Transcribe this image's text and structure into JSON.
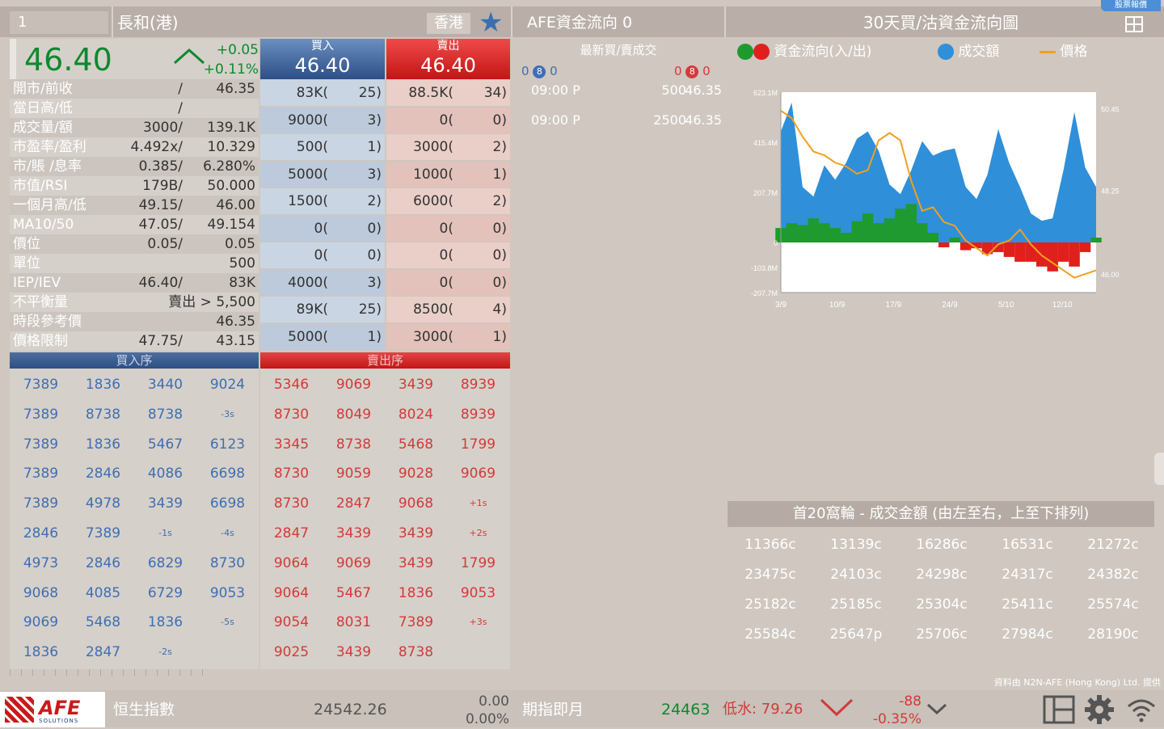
{
  "header": {
    "code": "1",
    "name": "長和(港)",
    "market": "香港",
    "afe_title": "AFE資金流向 0",
    "chart_title": "30天買/沽資金流向圖",
    "corner_badge": "股票報價"
  },
  "quote": {
    "price": "46.40",
    "change": "+0.05",
    "change_pct": "+0.11%",
    "rows": [
      {
        "label": "開市/前收",
        "v1": "/",
        "v2": "46.35"
      },
      {
        "label": "當日高/低",
        "v1": "/",
        "v2": ""
      },
      {
        "label": "成交量/額",
        "v1": "3000/",
        "v2": "139.1K"
      },
      {
        "label": "市盈率/盈利",
        "v1": "4.492x/",
        "v2": "10.329"
      },
      {
        "label": "市/賬 /息率",
        "v1": "0.385/",
        "v2": "6.280%"
      },
      {
        "label": "市值/RSI",
        "v1": "179B/",
        "v2": "50.000"
      },
      {
        "label": "一個月高/低",
        "v1": "49.15/",
        "v2": "46.00"
      },
      {
        "label": "MA10/50",
        "v1": "47.05/",
        "v2": "49.154"
      },
      {
        "label": "價位",
        "v1": "0.05/",
        "v2": "0.05"
      },
      {
        "label": "單位",
        "v1": "",
        "v2": "500"
      },
      {
        "label": "IEP/IEV",
        "v1": "46.40/",
        "v2": "83K"
      },
      {
        "label": "不平衡量",
        "v1": "",
        "v2": "賣出 > 5,500"
      },
      {
        "label": "時段參考價",
        "v1": "",
        "v2": "46.35"
      },
      {
        "label": "價格限制",
        "v1": "47.75/",
        "v2": "43.15"
      }
    ]
  },
  "orderbook": {
    "buy_label": "買入",
    "sell_label": "賣出",
    "bid": "46.40",
    "ask": "46.40",
    "bids": [
      {
        "q": "83K(",
        "n": "25)"
      },
      {
        "q": "9000(",
        "n": "3)"
      },
      {
        "q": "500(",
        "n": "1)"
      },
      {
        "q": "5000(",
        "n": "3)"
      },
      {
        "q": "1500(",
        "n": "2)"
      },
      {
        "q": "0(",
        "n": "0)"
      },
      {
        "q": "0(",
        "n": "0)"
      },
      {
        "q": "4000(",
        "n": "3)"
      },
      {
        "q": "89K(",
        "n": "25)"
      },
      {
        "q": "5000(",
        "n": "1)"
      }
    ],
    "asks": [
      {
        "q": "88.5K(",
        "n": "34)"
      },
      {
        "q": "0(",
        "n": "0)"
      },
      {
        "q": "3000(",
        "n": "2)"
      },
      {
        "q": "1000(",
        "n": "1)"
      },
      {
        "q": "6000(",
        "n": "2)"
      },
      {
        "q": "0(",
        "n": "0)"
      },
      {
        "q": "0(",
        "n": "0)"
      },
      {
        "q": "0(",
        "n": "0)"
      },
      {
        "q": "8500(",
        "n": "4)"
      },
      {
        "q": "3000(",
        "n": "1)"
      }
    ]
  },
  "queue": {
    "buy_title": "買入序",
    "sell_title": "賣出序",
    "buy": [
      [
        "7389",
        "1836",
        "3440",
        "9024"
      ],
      [
        "7389",
        "8738",
        "8738",
        "-3s"
      ],
      [
        "7389",
        "1836",
        "5467",
        "6123"
      ],
      [
        "7389",
        "2846",
        "4086",
        "6698"
      ],
      [
        "7389",
        "4978",
        "3439",
        "6698"
      ],
      [
        "2846",
        "7389",
        "-1s",
        "-4s"
      ],
      [
        "4973",
        "2846",
        "6829",
        "8730"
      ],
      [
        "9068",
        "4085",
        "6729",
        "9053"
      ],
      [
        "9069",
        "5468",
        "1836",
        "-5s"
      ],
      [
        "1836",
        "2847",
        "-2s",
        ""
      ]
    ],
    "sell": [
      [
        "5346",
        "9069",
        "3439",
        "8939"
      ],
      [
        "8730",
        "8049",
        "8024",
        "8939"
      ],
      [
        "3345",
        "8738",
        "5468",
        "1799"
      ],
      [
        "8730",
        "9059",
        "9028",
        "9069"
      ],
      [
        "8730",
        "2847",
        "9068",
        "+1s"
      ],
      [
        "2847",
        "3439",
        "3439",
        "+2s"
      ],
      [
        "9064",
        "9069",
        "3439",
        "1799"
      ],
      [
        "9064",
        "5467",
        "1836",
        "9053"
      ],
      [
        "9054",
        "8031",
        "7389",
        "+3s"
      ],
      [
        "9025",
        "3439",
        "8738",
        ""
      ]
    ]
  },
  "trades": {
    "header": "最新買/賣成交",
    "buy_counts": [
      "0",
      "8",
      "0"
    ],
    "sell_counts": [
      "0",
      "8",
      "0"
    ],
    "rows": [
      {
        "time": "09:00 P",
        "size": "500",
        "price": "46.35"
      },
      {
        "time": "09:00 P",
        "size": "2500",
        "price": "46.35"
      }
    ]
  },
  "chart_legend": {
    "flow": "資金流向(入/出)",
    "turnover": "成交額",
    "price": "價格"
  },
  "chart_data": {
    "type": "area",
    "x": [
      "3/9",
      "10/9",
      "17/9",
      "24/9",
      "5/10",
      "12/10"
    ],
    "y_left_ticks": [
      "623.1M",
      "415.4M",
      "207.7M",
      "0",
      "-103.8M",
      "-207.7M"
    ],
    "y_right_ticks": [
      "50.45",
      "48.25",
      "46.00"
    ],
    "ylim": [
      -207.7,
      623.1
    ],
    "y2lim": [
      45.5,
      50.9
    ],
    "turnover": [
      460,
      580,
      230,
      190,
      320,
      260,
      330,
      430,
      460,
      380,
      240,
      200,
      300,
      420,
      360,
      380,
      390,
      230,
      180,
      280,
      470,
      330,
      230,
      120,
      90,
      100,
      300,
      540,
      310,
      230
    ],
    "flow": [
      15,
      20,
      18,
      25,
      20,
      15,
      10,
      22,
      30,
      20,
      25,
      35,
      40,
      20,
      10,
      -5,
      5,
      -8,
      -6,
      -12,
      -10,
      -15,
      -20,
      -20,
      -25,
      -30,
      -20,
      -25,
      -10,
      5
    ],
    "price": [
      50.4,
      50.2,
      49.7,
      49.3,
      49.2,
      49.0,
      48.9,
      48.7,
      48.8,
      49.6,
      49.8,
      49.6,
      48.5,
      47.7,
      47.8,
      47.4,
      47.3,
      46.9,
      46.7,
      46.5,
      46.8,
      46.9,
      47.2,
      46.8,
      46.5,
      46.3,
      46.1,
      45.9,
      46.0,
      46.1
    ],
    "colors": {
      "turnover": "#2f8fd9",
      "flow_in": "#1f9a2f",
      "flow_out": "#e0201c",
      "price": "#f0a020",
      "flow_legend_in": "#1f9a2f",
      "flow_legend_out": "#e0201c"
    }
  },
  "top20": {
    "title": "首20窩輪 - 成交金額 (由左至右，上至下排列)",
    "codes": [
      "11366c",
      "13139c",
      "16286c",
      "16531c",
      "21272c",
      "23475c",
      "24103c",
      "24298c",
      "24317c",
      "24382c",
      "25182c",
      "25185c",
      "25304c",
      "25411c",
      "25574c",
      "25584c",
      "25647p",
      "25706c",
      "27984c",
      "28190c"
    ]
  },
  "credit": "資料由 N2N-AFE (Hong Kong) Ltd. 提供",
  "footer": {
    "logo_text": "AFE",
    "logo_sub": "SOLUTIONS",
    "index_name": "恒生指數",
    "index_value": "24542.26",
    "index_change": "0.00",
    "index_change_pct": "0.00%",
    "futures_name": "期指即月",
    "futures_value": "24463",
    "futures_discount": "低水: 79.26",
    "futures_change": "-88",
    "futures_change_pct": "-0.35%"
  }
}
